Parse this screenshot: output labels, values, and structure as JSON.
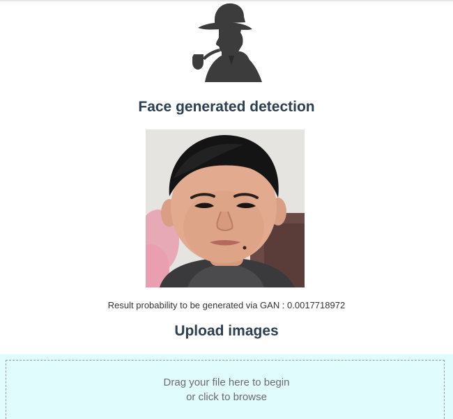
{
  "header": {
    "logo_icon": "detective-silhouette-icon",
    "title": "Face generated detection"
  },
  "result": {
    "text": "Result probability to be generated via GAN : 0.0017718972"
  },
  "upload": {
    "title": "Upload images",
    "drop_line1": "Drag your file here to begin",
    "drop_line2": "or click to browse"
  },
  "colors": {
    "heading": "#2c3e50",
    "dropzone_bg": "#e0fcfd",
    "silhouette": "#3c3c3c"
  }
}
